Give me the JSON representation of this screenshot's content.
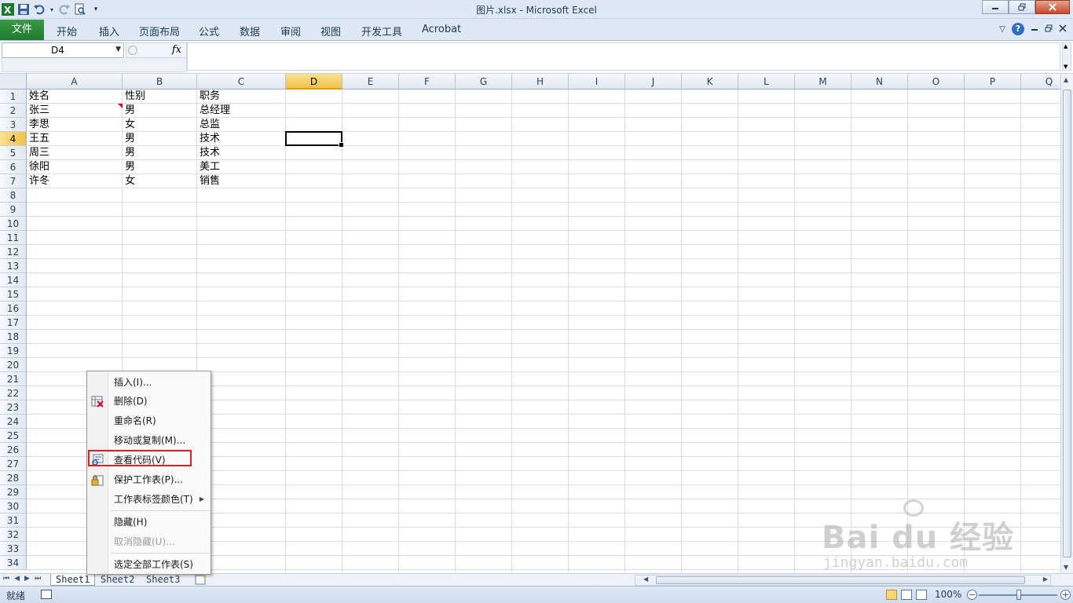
{
  "window": {
    "title": "图片.xlsx - Microsoft Excel"
  },
  "ribbon": {
    "file_tab": "文件",
    "tabs": [
      "开始",
      "插入",
      "页面布局",
      "公式",
      "数据",
      "审阅",
      "视图",
      "开发工具",
      "Acrobat"
    ]
  },
  "formula_bar": {
    "name_box": "D4",
    "fx_label": "fx",
    "value": ""
  },
  "sheet": {
    "columns": [
      "A",
      "B",
      "C",
      "D",
      "E",
      "F",
      "G",
      "H",
      "I",
      "J",
      "K",
      "L",
      "M",
      "N",
      "O",
      "P",
      "Q"
    ],
    "rows": [
      "1",
      "2",
      "3",
      "4",
      "5",
      "6",
      "7",
      "8",
      "9",
      "10",
      "11",
      "12",
      "13",
      "14",
      "15",
      "16",
      "17",
      "18",
      "19",
      "20",
      "21",
      "22",
      "23",
      "24",
      "25",
      "26",
      "27",
      "28",
      "29",
      "30",
      "31",
      "32",
      "33",
      "34"
    ],
    "selected_column": "D",
    "selected_row": "4",
    "cells": [
      [
        "姓名",
        "性别",
        "职务"
      ],
      [
        "张三",
        "男",
        "总经理"
      ],
      [
        "李思",
        "女",
        "总监"
      ],
      [
        "王五",
        "男",
        "技术"
      ],
      [
        "周三",
        "男",
        "技术"
      ],
      [
        "徐阳",
        "男",
        "美工"
      ],
      [
        "许冬",
        "女",
        "销售"
      ]
    ]
  },
  "sheet_tabs": [
    "Sheet1",
    "Sheet2",
    "Sheet3"
  ],
  "context_menu": {
    "items": [
      {
        "label": "插入(I)...",
        "icon": "",
        "disabled": false
      },
      {
        "label": "删除(D)",
        "icon": "delete-sheet-icon",
        "disabled": false
      },
      {
        "label": "重命名(R)",
        "icon": "",
        "disabled": false
      },
      {
        "label": "移动或复制(M)...",
        "icon": "",
        "disabled": false
      },
      {
        "label": "查看代码(V)",
        "icon": "view-code-icon",
        "disabled": false
      },
      {
        "label": "保护工作表(P)...",
        "icon": "protect-sheet-icon",
        "disabled": false
      },
      {
        "label": "工作表标签颜色(T)",
        "icon": "",
        "disabled": false,
        "submenu": true
      },
      {
        "label": "隐藏(H)",
        "icon": "",
        "disabled": false
      },
      {
        "label": "取消隐藏(U)...",
        "icon": "",
        "disabled": true
      },
      {
        "label": "选定全部工作表(S)",
        "icon": "",
        "disabled": false
      }
    ],
    "highlighted": "查看代码(V)"
  },
  "status_bar": {
    "status": "就绪",
    "zoom": "100%"
  },
  "watermark": {
    "text": "Bai du 经验",
    "sub": "jingyan.baidu.com"
  },
  "colors": {
    "file_tab": "#1f7a2d",
    "selected_header": "#f1c14a",
    "highlight_box": "#e02020"
  }
}
